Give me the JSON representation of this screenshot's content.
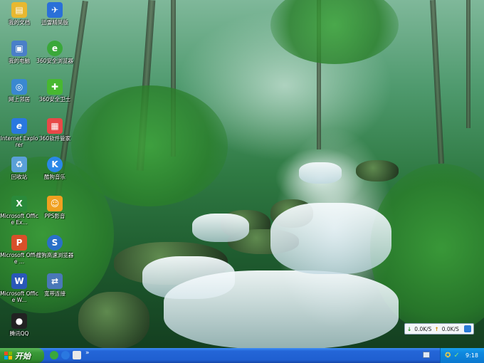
{
  "desktop_icons": [
    {
      "label": "我的文档",
      "icon": "folder-documents-icon",
      "color": "#e8b830"
    },
    {
      "label": "迅雷精简版",
      "icon": "thunder-bird-icon",
      "color": "#2a70d8"
    },
    {
      "label": "我的电脑",
      "icon": "computer-icon",
      "color": "#4a7fc8"
    },
    {
      "label": "360安全浏览器",
      "icon": "browser-360-icon",
      "color": "#3aa83a"
    },
    {
      "label": "网上邻居",
      "icon": "network-icon",
      "color": "#3a88d0"
    },
    {
      "label": "360安全卫士",
      "icon": "shield-360-icon",
      "color": "#48b830"
    },
    {
      "label": "Internet Explorer",
      "icon": "ie-icon",
      "color": "#2a78e0"
    },
    {
      "label": "360软件管家",
      "icon": "software-manager-icon",
      "color": "#e84848"
    },
    {
      "label": "回收站",
      "icon": "recycle-bin-icon",
      "color": "#5aa0d8"
    },
    {
      "label": "酷狗音乐",
      "icon": "kugou-icon",
      "color": "#2a88e8"
    },
    {
      "label": "Microsoft Office Ex...",
      "icon": "excel-icon",
      "color": "#2a8a3a"
    },
    {
      "label": "PPS影音",
      "icon": "pps-icon",
      "color": "#f0a020"
    },
    {
      "label": "Microsoft Office ...",
      "icon": "powerpoint-icon",
      "color": "#d8502a"
    },
    {
      "label": "搜狗高速浏览器",
      "icon": "sogou-browser-icon",
      "color": "#2a70c8"
    },
    {
      "label": "Microsoft Office W...",
      "icon": "word-icon",
      "color": "#2a58b8"
    },
    {
      "label": "宽带连接",
      "icon": "broadband-icon",
      "color": "#4a78b8"
    },
    {
      "label": "腾讯QQ",
      "icon": "qq-penguin-icon",
      "color": "#222222"
    }
  ],
  "speed_widget": {
    "down": "0.0K/S",
    "up": "0.0K/S",
    "down_arrow": "↓",
    "up_arrow": "↑"
  },
  "taskbar": {
    "start_label": "开始",
    "quick_launch_more": "»",
    "clock": "9:18"
  },
  "colors": {
    "taskbar": "#2466d8",
    "start": "#3a9a38",
    "tray": "#0e8ae0"
  }
}
